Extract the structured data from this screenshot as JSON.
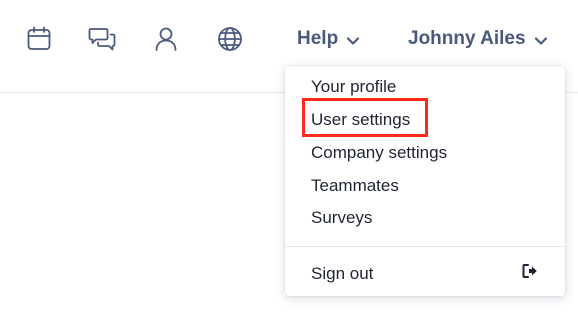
{
  "topbar": {
    "icons": [
      "calendar-icon",
      "chat-icon",
      "user-icon",
      "globe-icon"
    ],
    "help_label": "Help",
    "user_name": "Johnny Ailes"
  },
  "dropdown": {
    "items": [
      {
        "label": "Your profile"
      },
      {
        "label": "User settings"
      },
      {
        "label": "Company settings"
      },
      {
        "label": "Teammates"
      },
      {
        "label": "Surveys"
      }
    ],
    "sign_out_label": "Sign out",
    "sign_out_icon": "sign-out-icon"
  },
  "colors": {
    "icon": "#4b5a7c",
    "text": "#1f2433",
    "highlight": "#ff2a1a",
    "divider": "#e3e6ee"
  }
}
